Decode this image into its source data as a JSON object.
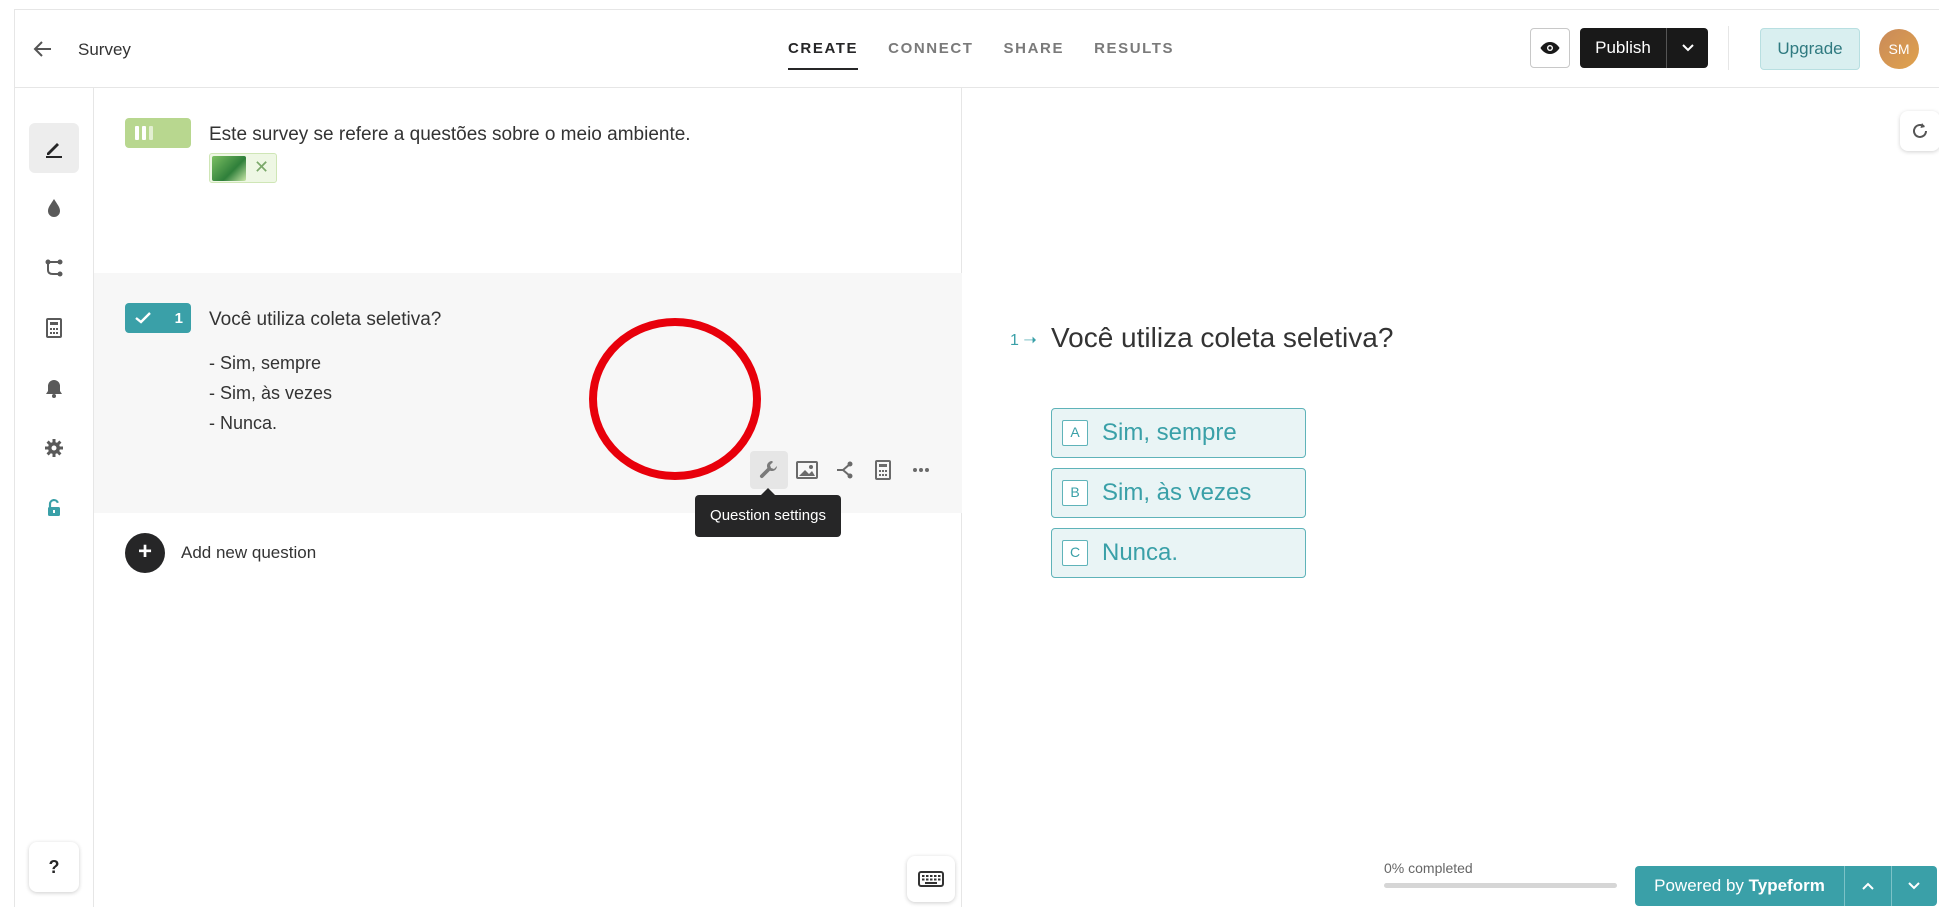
{
  "header": {
    "back_icon": "arrow-left-icon",
    "title": "Survey",
    "tabs": [
      {
        "label": "CREATE",
        "active": true
      },
      {
        "label": "CONNECT",
        "active": false
      },
      {
        "label": "SHARE",
        "active": false
      },
      {
        "label": "RESULTS",
        "active": false
      }
    ],
    "preview_icon": "eye-icon",
    "publish_label": "Publish",
    "upgrade_label": "Upgrade",
    "avatar_initials": "SM"
  },
  "rail": {
    "items": [
      "pencil-icon",
      "drop-icon",
      "logic-icon",
      "calculator-icon",
      "bell-icon",
      "gear-icon",
      "lock-open-icon"
    ],
    "help_label": "?"
  },
  "builder": {
    "welcome_text": "Este survey se refere a questões sobre o meio ambiente.",
    "question_number": "1",
    "question_text": "Você utiliza coleta seletiva?",
    "options": [
      "- Sim, sempre",
      "- Sim, às vezes",
      "- Nunca."
    ],
    "tooltip": "Question settings",
    "add_question_label": "Add new question"
  },
  "preview": {
    "question_number": "1",
    "question_text": "Você utiliza coleta seletiva?",
    "choices": [
      {
        "key": "A",
        "label": "Sim, sempre"
      },
      {
        "key": "B",
        "label": "Sim, às vezes"
      },
      {
        "key": "C",
        "label": "Nunca."
      }
    ],
    "progress_text": "0% completed",
    "progress_value": 0,
    "powered_prefix": "Powered by ",
    "powered_brand": "Typeform"
  },
  "colors": {
    "accent": "#3aa0a8",
    "welcome_badge": "#b8d78f",
    "highlight_ring": "#e8000b"
  }
}
